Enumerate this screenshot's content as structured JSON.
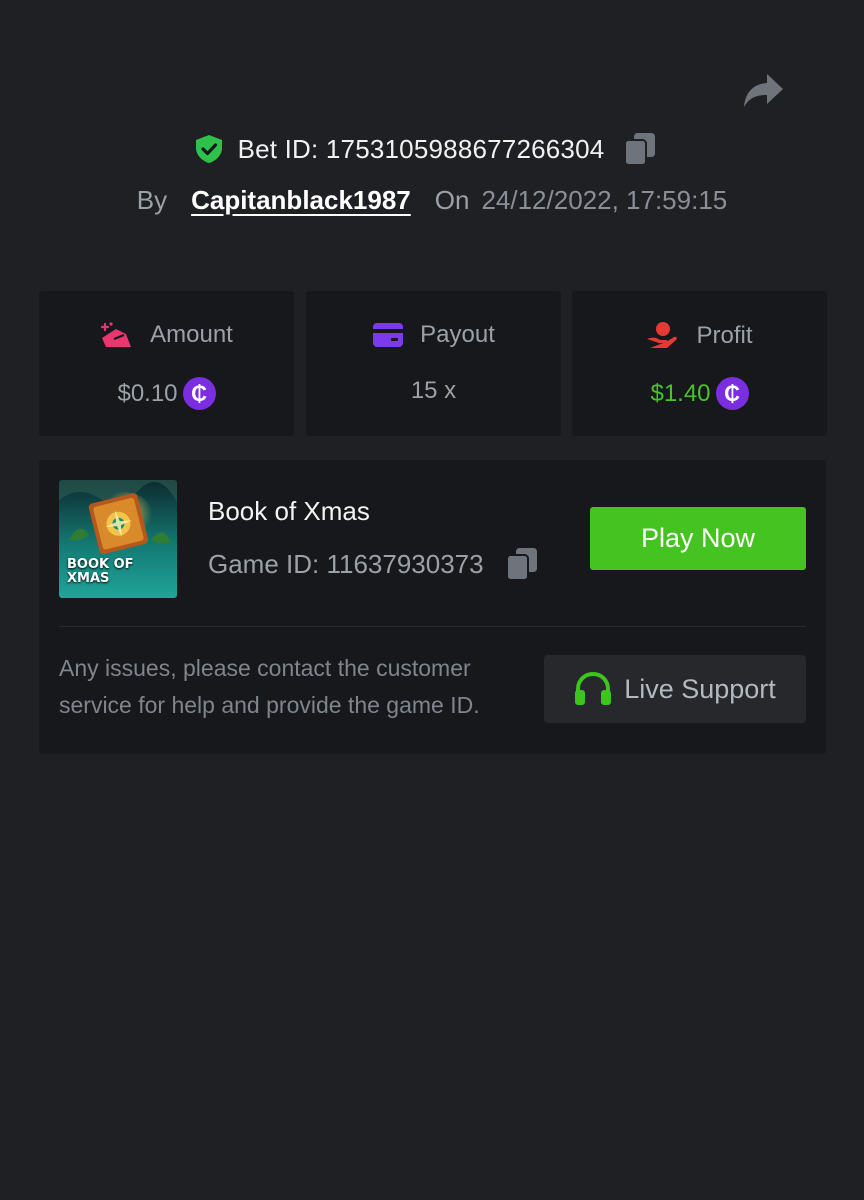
{
  "header": {
    "bet_id_label": "Bet ID: 1753105988677266304",
    "by_label": "By",
    "username": "Capitanblack1987",
    "on_label": "On",
    "datetime": "24/12/2022, 17:59:15"
  },
  "stats": {
    "amount": {
      "label": "Amount",
      "value": "$0.10",
      "icon": "amount-icon"
    },
    "payout": {
      "label": "Payout",
      "value": "15 x",
      "icon": "card-icon"
    },
    "profit": {
      "label": "Profit",
      "value": "$1.40",
      "icon": "profit-hand-icon"
    },
    "coin_symbol": "₵"
  },
  "game": {
    "name": "Book of Xmas",
    "game_id_label": "Game ID: 11637930373",
    "thumb_text_line1": "BOOK OF",
    "thumb_text_line2": "XMAS",
    "play_button": "Play Now"
  },
  "support": {
    "help_text": "Any issues, please contact the customer service for help and provide the game ID.",
    "button_label": "Live Support"
  },
  "colors": {
    "background": "#1f2023",
    "card": "#17181b",
    "accent_green": "#45c321",
    "coin_purple": "#7a2ee0",
    "amount_pink": "#e8366e",
    "payout_purple": "#7c3aed",
    "profit_red": "#e53935"
  }
}
